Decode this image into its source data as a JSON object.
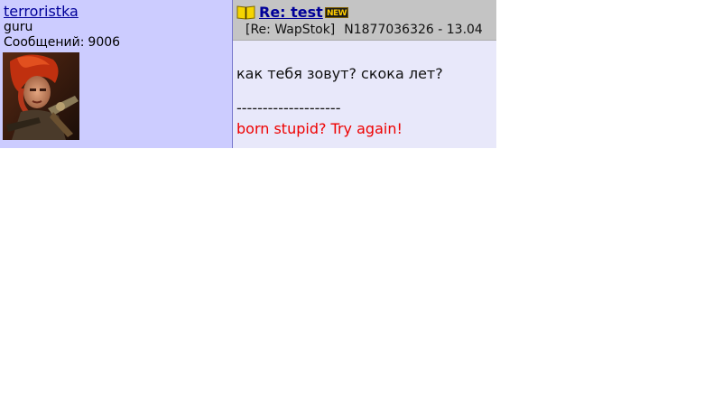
{
  "author": {
    "name": "terroristka",
    "rank": "guru",
    "posts_label": "Сообщений:",
    "posts_count": "9006"
  },
  "post": {
    "title": "Re: test",
    "new_badge": "NEW",
    "section": "[Re: WapStok]",
    "meta_info": "N1877036326 - 13.04",
    "message": "как тебя зовут? скока лет?",
    "divider": "--------------------",
    "signature": "born stupid? Try again!"
  },
  "colors": {
    "author_bg": "#ccccff",
    "header_bg": "#c4c4c4",
    "body_bg": "#e8e8fa",
    "link": "#000099",
    "signature": "#ee0000"
  },
  "icons": {
    "topic": "book-icon",
    "new": "new-badge"
  }
}
